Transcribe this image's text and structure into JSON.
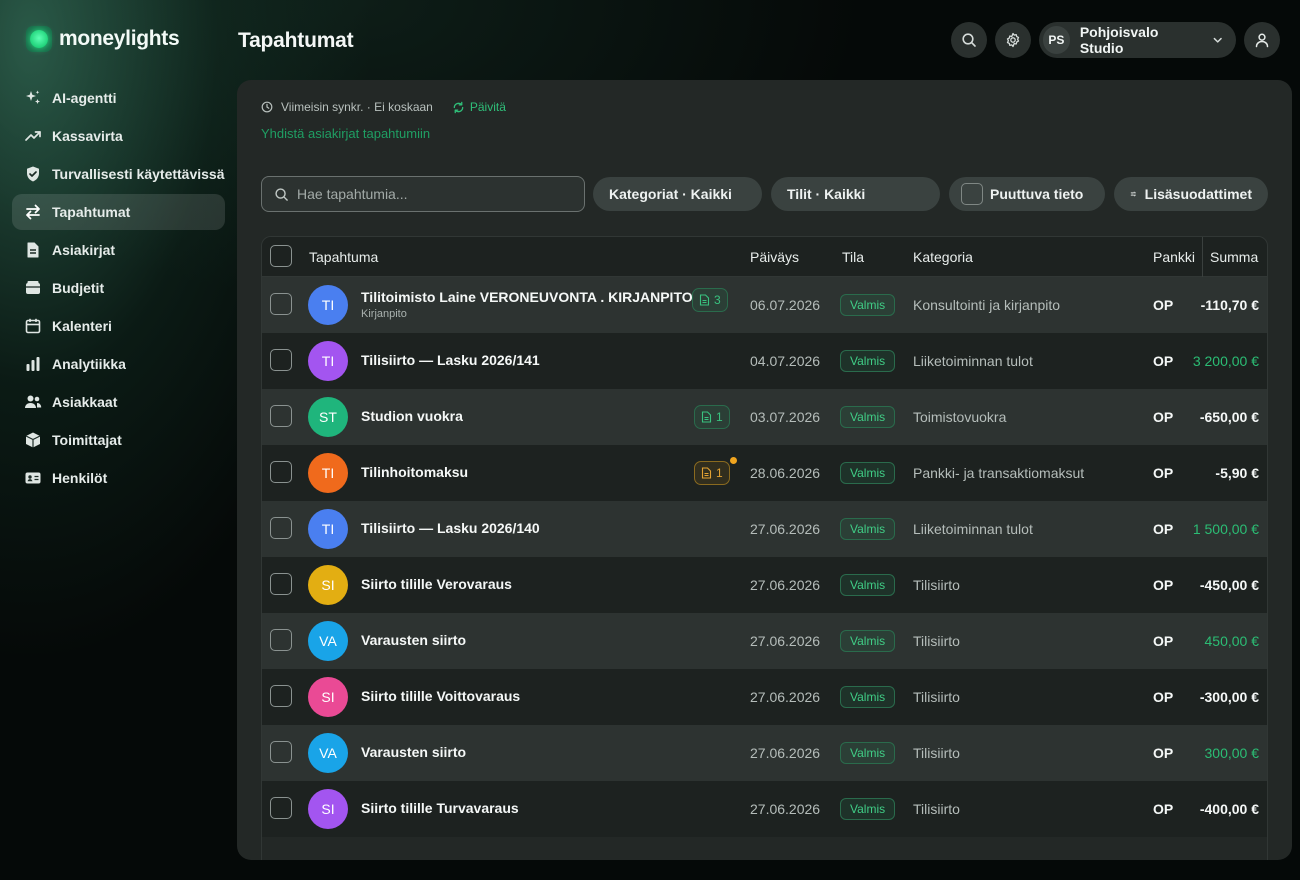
{
  "app": {
    "name": "moneylights"
  },
  "nav": [
    {
      "label": "AI-agentti",
      "icon": "sparkle-icon",
      "active": false
    },
    {
      "label": "Kassavirta",
      "icon": "trend-up-icon",
      "active": false
    },
    {
      "label": "Turvallisesti käytettävissä",
      "icon": "shield-check-icon",
      "active": false
    },
    {
      "label": "Tapahtumat",
      "icon": "arrows-swap-icon",
      "active": true
    },
    {
      "label": "Asiakirjat",
      "icon": "document-icon",
      "active": false
    },
    {
      "label": "Budjetit",
      "icon": "wallet-icon",
      "active": false
    },
    {
      "label": "Kalenteri",
      "icon": "calendar-icon",
      "active": false
    },
    {
      "label": "Analytiikka",
      "icon": "bar-chart-icon",
      "active": false
    },
    {
      "label": "Asiakkaat",
      "icon": "users-icon",
      "active": false
    },
    {
      "label": "Toimittajat",
      "icon": "box-icon",
      "active": false
    },
    {
      "label": "Henkilöt",
      "icon": "id-card-icon",
      "active": false
    }
  ],
  "header": {
    "title": "Tapahtumat",
    "org_initials": "PS",
    "org_name": "Pohjoisvalo Studio"
  },
  "sync": {
    "text": "Viimeisin synkr. · Ei koskaan",
    "refresh_label": "Päivitä",
    "link_documents": "Yhdistä asiakirjat tapahtumiin"
  },
  "search": {
    "placeholder": "Hae tapahtumia..."
  },
  "filters": {
    "categories": "Kategoriat · Kaikki",
    "accounts": "Tilit · Kaikki",
    "missing": "Puuttuva tieto",
    "more": "Lisäsuodattimet"
  },
  "table": {
    "headers": {
      "transaction": "Tapahtuma",
      "date": "Päiväys",
      "status": "Tila",
      "category": "Kategoria",
      "bank": "Pankki",
      "amount": "Summa"
    },
    "rows": [
      {
        "initials": "TI",
        "avatar_color": "#4a7ff0",
        "title": "Tilitoimisto Laine VERONEUVONTA . KIRJANPITO",
        "subtitle": "Kirjanpito",
        "docs": "3",
        "doc_state": "ok",
        "date": "06.07.2026",
        "status": "Valmis",
        "category": "Konsultointi ja kirjanpito",
        "bank": "OP",
        "amount": "-110,70 €",
        "positive": false
      },
      {
        "initials": "TI",
        "avatar_color": "#a355f0",
        "title": "Tilisiirto — Lasku 2026/141",
        "subtitle": "",
        "docs": "",
        "doc_state": "",
        "date": "04.07.2026",
        "status": "Valmis",
        "category": "Liiketoiminnan tulot",
        "bank": "OP",
        "amount": "3 200,00 €",
        "positive": true
      },
      {
        "initials": "ST",
        "avatar_color": "#1fb57c",
        "title": "Studion vuokra",
        "subtitle": "",
        "docs": "1",
        "doc_state": "ok",
        "date": "03.07.2026",
        "status": "Valmis",
        "category": "Toimistovuokra",
        "bank": "OP",
        "amount": "-650,00 €",
        "positive": false
      },
      {
        "initials": "TI",
        "avatar_color": "#f06a1c",
        "title": "Tilinhoitomaksu",
        "subtitle": "",
        "docs": "1",
        "doc_state": "warn",
        "date": "28.06.2026",
        "status": "Valmis",
        "category": "Pankki- ja transaktiomaksut",
        "bank": "OP",
        "amount": "-5,90 €",
        "positive": false
      },
      {
        "initials": "TI",
        "avatar_color": "#4a7ff0",
        "title": "Tilisiirto — Lasku 2026/140",
        "subtitle": "",
        "docs": "",
        "doc_state": "",
        "date": "27.06.2026",
        "status": "Valmis",
        "category": "Liiketoiminnan tulot",
        "bank": "OP",
        "amount": "1 500,00 €",
        "positive": true
      },
      {
        "initials": "SI",
        "avatar_color": "#e3ae12",
        "title": "Siirto tilille Verovaraus",
        "subtitle": "",
        "docs": "",
        "doc_state": "",
        "date": "27.06.2026",
        "status": "Valmis",
        "category": "Tilisiirto",
        "bank": "OP",
        "amount": "-450,00 €",
        "positive": false
      },
      {
        "initials": "VA",
        "avatar_color": "#19a4e8",
        "title": "Varausten siirto",
        "subtitle": "",
        "docs": "",
        "doc_state": "",
        "date": "27.06.2026",
        "status": "Valmis",
        "category": "Tilisiirto",
        "bank": "OP",
        "amount": "450,00 €",
        "positive": true
      },
      {
        "initials": "SI",
        "avatar_color": "#ea4a95",
        "title": "Siirto tilille Voittovaraus",
        "subtitle": "",
        "docs": "",
        "doc_state": "",
        "date": "27.06.2026",
        "status": "Valmis",
        "category": "Tilisiirto",
        "bank": "OP",
        "amount": "-300,00 €",
        "positive": false
      },
      {
        "initials": "VA",
        "avatar_color": "#19a4e8",
        "title": "Varausten siirto",
        "subtitle": "",
        "docs": "",
        "doc_state": "",
        "date": "27.06.2026",
        "status": "Valmis",
        "category": "Tilisiirto",
        "bank": "OP",
        "amount": "300,00 €",
        "positive": true
      },
      {
        "initials": "SI",
        "avatar_color": "#a355f0",
        "title": "Siirto tilille Turvavaraus",
        "subtitle": "",
        "docs": "",
        "doc_state": "",
        "date": "27.06.2026",
        "status": "Valmis",
        "category": "Tilisiirto",
        "bank": "OP",
        "amount": "-400,00 €",
        "positive": false
      }
    ]
  },
  "colors": {
    "accent": "#2bbd74",
    "panel": "#232826",
    "background": "#050908"
  }
}
